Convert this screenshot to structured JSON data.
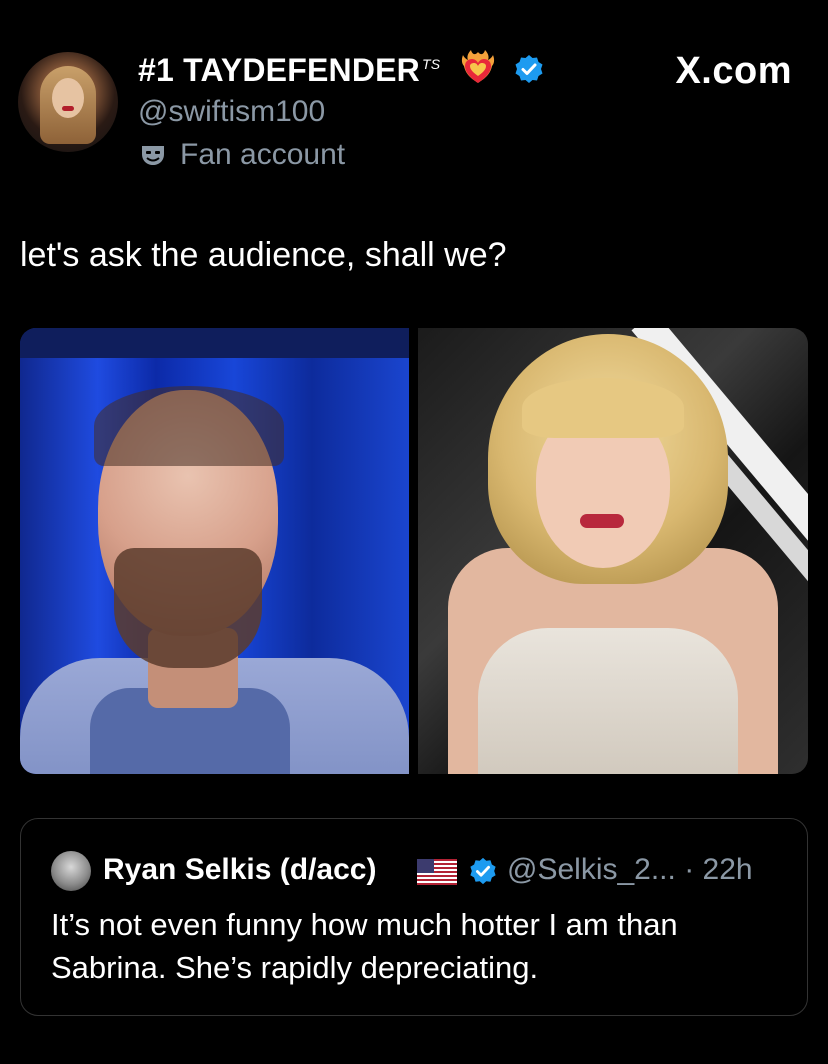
{
  "header": {
    "display_name": "#1 TAYDEFENDER",
    "name_suffix": "TS",
    "handle": "@swiftism100",
    "account_label": "Fan account",
    "brand": "X.com"
  },
  "post": {
    "text": "let's ask the audience, shall we?"
  },
  "quoted_post": {
    "author_name": "Ryan Selkis (d/acc)",
    "meta": "@Selkis_2... · 22h",
    "text": "It’s not even funny how much hotter I am than Sabrina. She’s rapidly depreciating."
  },
  "colors": {
    "background": "#000000",
    "text": "#ffffff",
    "secondary_text": "#8b98a5",
    "verified_blue": "#1d9bf0"
  }
}
